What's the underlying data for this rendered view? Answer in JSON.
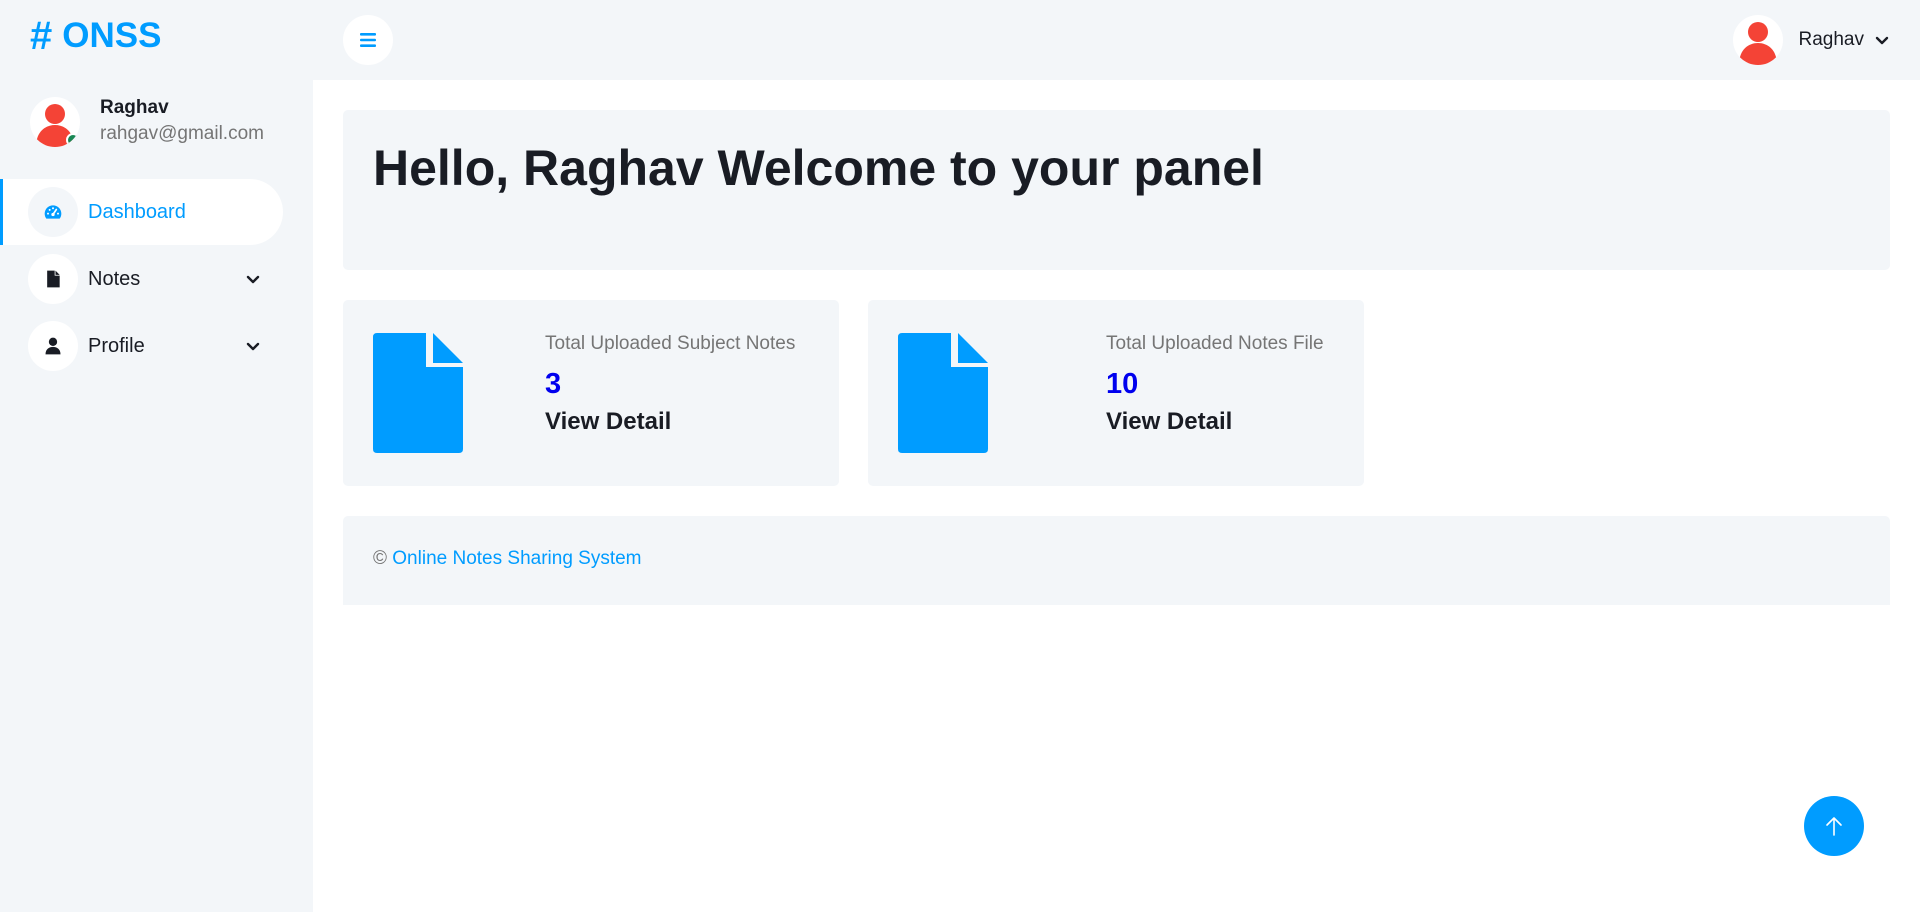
{
  "brand": {
    "text": "ONSS",
    "icon": "hashtag-icon",
    "color": "#009cff"
  },
  "sidebar": {
    "user": {
      "name": "Raghav",
      "email": "rahgav@gmail.com",
      "status": "online"
    },
    "items": [
      {
        "label": "Dashboard",
        "icon": "tachometer-icon",
        "active": true
      },
      {
        "label": "Notes",
        "icon": "file-icon",
        "has_submenu": true
      },
      {
        "label": "Profile",
        "icon": "user-icon",
        "has_submenu": true
      }
    ]
  },
  "topbar": {
    "user_name": "Raghav"
  },
  "welcome": {
    "heading": "Hello, Raghav Welcome to your panel"
  },
  "cards": [
    {
      "title": "Total Uploaded Subject Notes",
      "value": "3",
      "link": "View Detail",
      "icon": "file-icon"
    },
    {
      "title": "Total Uploaded Notes File",
      "value": "10",
      "link": "View Detail",
      "icon": "file-icon"
    }
  ],
  "footer": {
    "copyright": "©",
    "link_text": "Online Notes Sharing System"
  },
  "colors": {
    "primary": "#009cff",
    "background": "#f3f6f9",
    "value": "#0000ee",
    "online": "#198754",
    "avatar": "#f44336"
  }
}
